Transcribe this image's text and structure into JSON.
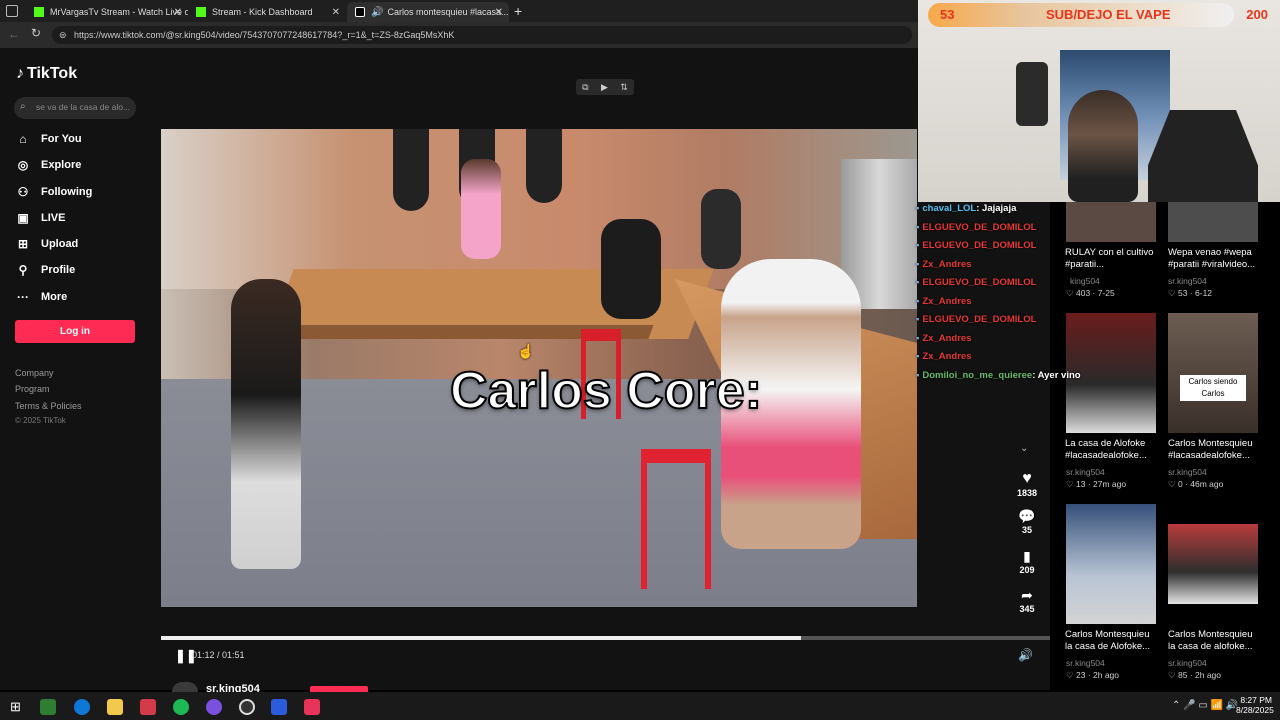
{
  "tabs": [
    {
      "label": "MrVargasTv Stream - Watch Live o..."
    },
    {
      "label": "Stream - Kick Dashboard"
    },
    {
      "label": "Carlos montesquieu #lacasa..."
    }
  ],
  "url": "https://www.tiktok.com/@sr.king504/video/7543707077248617784?_r=1&_t=ZS-8zGaq5MsXhK",
  "sidebar": {
    "logo": "TikTok",
    "search_placeholder": "se va de la casa de alo...",
    "nav": [
      {
        "label": "For You",
        "icon": "home-icon"
      },
      {
        "label": "Explore",
        "icon": "compass-icon"
      },
      {
        "label": "Following",
        "icon": "following-icon"
      },
      {
        "label": "LIVE",
        "icon": "live-icon"
      },
      {
        "label": "Upload",
        "icon": "upload-icon"
      },
      {
        "label": "Profile",
        "icon": "profile-icon"
      },
      {
        "label": "More",
        "icon": "more-icon"
      }
    ],
    "login": "Log in",
    "footer": [
      "Company",
      "Program",
      "Terms & Policies",
      "© 2025 TikTok"
    ]
  },
  "video": {
    "caption": "Carlos Core:",
    "time": "01:12 / 01:51",
    "progress": 0.72,
    "author": "sr.king504",
    "likes": "1838",
    "comments": "35",
    "saves": "209",
    "shares": "345"
  },
  "overlay": {
    "left_count": "53",
    "title": "SUB/DEJO EL VAPE",
    "right_count": "200"
  },
  "chat": [
    {
      "user": "chaval_LOL",
      "msg": ": Jajajaja",
      "color": "#4fc3f7"
    },
    {
      "user": "ELGUEVO_DE_DOMILOL",
      "msg": "",
      "color": "#e53935"
    },
    {
      "user": "ELGUEVO_DE_DOMILOL",
      "msg": "",
      "color": "#e53935"
    },
    {
      "user": "Zx_Andres",
      "msg": "",
      "color": "#e53935"
    },
    {
      "user": "ELGUEVO_DE_DOMILOL",
      "msg": "",
      "color": "#e53935"
    },
    {
      "user": "Zx_Andres",
      "msg": "",
      "color": "#e53935"
    },
    {
      "user": "ELGUEVO_DE_DOMILOL",
      "msg": "",
      "color": "#e53935"
    },
    {
      "user": "Zx_Andres",
      "msg": "",
      "color": "#e53935"
    },
    {
      "user": "Zx_Andres",
      "msg": "",
      "color": "#e53935"
    },
    {
      "user": "Domiloi_no_me_quieree",
      "msg": ": Ayer vino",
      "color": "#66bb6a"
    }
  ],
  "related": [
    {
      "title1": "RULAY con el cultivo",
      "title2": "#paratii...",
      "user": "king504",
      "likes": "403",
      "ago": "7-25"
    },
    {
      "title1": "Wepa venao #wepa",
      "title2": "#paratii #viralvideo...",
      "user": "sr.king504",
      "likes": "53",
      "ago": "6-12"
    },
    {
      "title1": "La casa de Alofoke",
      "title2": "#lacasadealofoke...",
      "user": "sr.king504",
      "likes": "13",
      "ago": "27m ago"
    },
    {
      "title1": "Carlos Montesquieu",
      "title2": "#lacasadealofoke...",
      "user": "sr.king504",
      "likes": "0",
      "ago": "46m ago",
      "thumb_text": "Carlos siendo Carlos"
    },
    {
      "title1": "Carlos Montesquieu",
      "title2": "la casa de Alofoke...",
      "user": "sr.king504",
      "likes": "23",
      "ago": "2h ago"
    },
    {
      "title1": "Carlos Montesquieu",
      "title2": "la casa de alofoke...",
      "user": "sr.king504",
      "likes": "85",
      "ago": "2h ago"
    }
  ],
  "taskbar": {
    "time": "8:27 PM",
    "date": "8/28/2025"
  }
}
